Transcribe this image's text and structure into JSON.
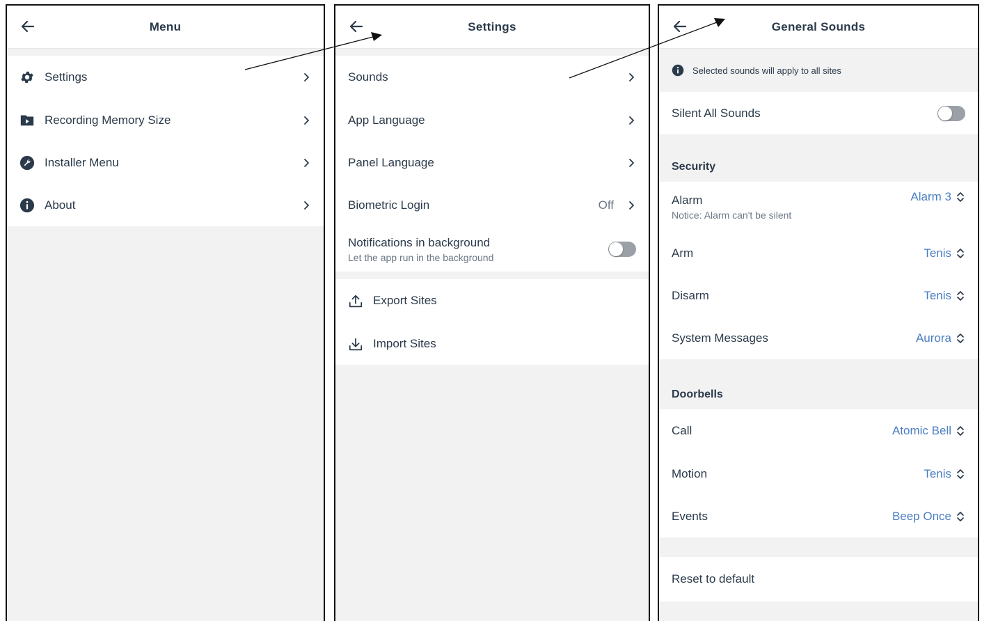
{
  "menu": {
    "title": "Menu",
    "back_icon": "arrow-left-icon",
    "items": [
      {
        "label": "Settings",
        "icon": "gear-icon"
      },
      {
        "label": "Recording Memory Size",
        "icon": "folder-play-icon"
      },
      {
        "label": "Installer Menu",
        "icon": "wrench-icon"
      },
      {
        "label": "About",
        "icon": "info-icon"
      }
    ]
  },
  "settings": {
    "title": "Settings",
    "back_icon": "arrow-left-icon",
    "items": [
      {
        "label": "Sounds"
      },
      {
        "label": "App Language"
      },
      {
        "label": "Panel Language"
      },
      {
        "label": "Biometric Login",
        "value": "Off"
      },
      {
        "label": "Notifications in background",
        "sublabel": "Let the app run in the background",
        "toggle": false
      }
    ],
    "actions": [
      {
        "label": "Export Sites",
        "icon": "upload-icon"
      },
      {
        "label": "Import Sites",
        "icon": "download-icon"
      }
    ]
  },
  "sounds": {
    "title": "General Sounds",
    "back_icon": "arrow-left-icon",
    "notice": "Selected sounds will apply to all sites",
    "silent_label": "Silent All Sounds",
    "silent_toggle": false,
    "security_heading": "Security",
    "security": [
      {
        "label": "Alarm",
        "sublabel": "Notice: Alarm can't be silent",
        "value": "Alarm 3"
      },
      {
        "label": "Arm",
        "value": "Tenis"
      },
      {
        "label": "Disarm",
        "value": "Tenis"
      },
      {
        "label": "System Messages",
        "value": "Aurora"
      }
    ],
    "doorbells_heading": "Doorbells",
    "doorbells": [
      {
        "label": "Call",
        "value": "Atomic Bell"
      },
      {
        "label": "Motion",
        "value": "Tenis"
      },
      {
        "label": "Events",
        "value": "Beep Once"
      }
    ],
    "reset_label": "Reset to default"
  },
  "colors": {
    "text": "#2b3a4a",
    "accent": "#4a7ec2",
    "background": "#f2f2f2",
    "toggle_off": "#9aa0a6"
  }
}
